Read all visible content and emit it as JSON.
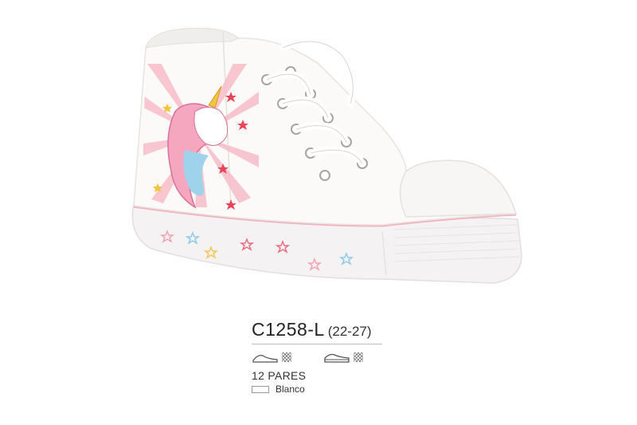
{
  "product": {
    "code": "C1258-L",
    "sizes": "(22-27)",
    "pairs": "12 PARES",
    "color_name": "Blanco",
    "color_hex": "#ffffff",
    "image": "white high-top canvas sneaker with pink unicorn print and stars",
    "icons": [
      "upper-material-icon",
      "sole-material-icon"
    ]
  }
}
